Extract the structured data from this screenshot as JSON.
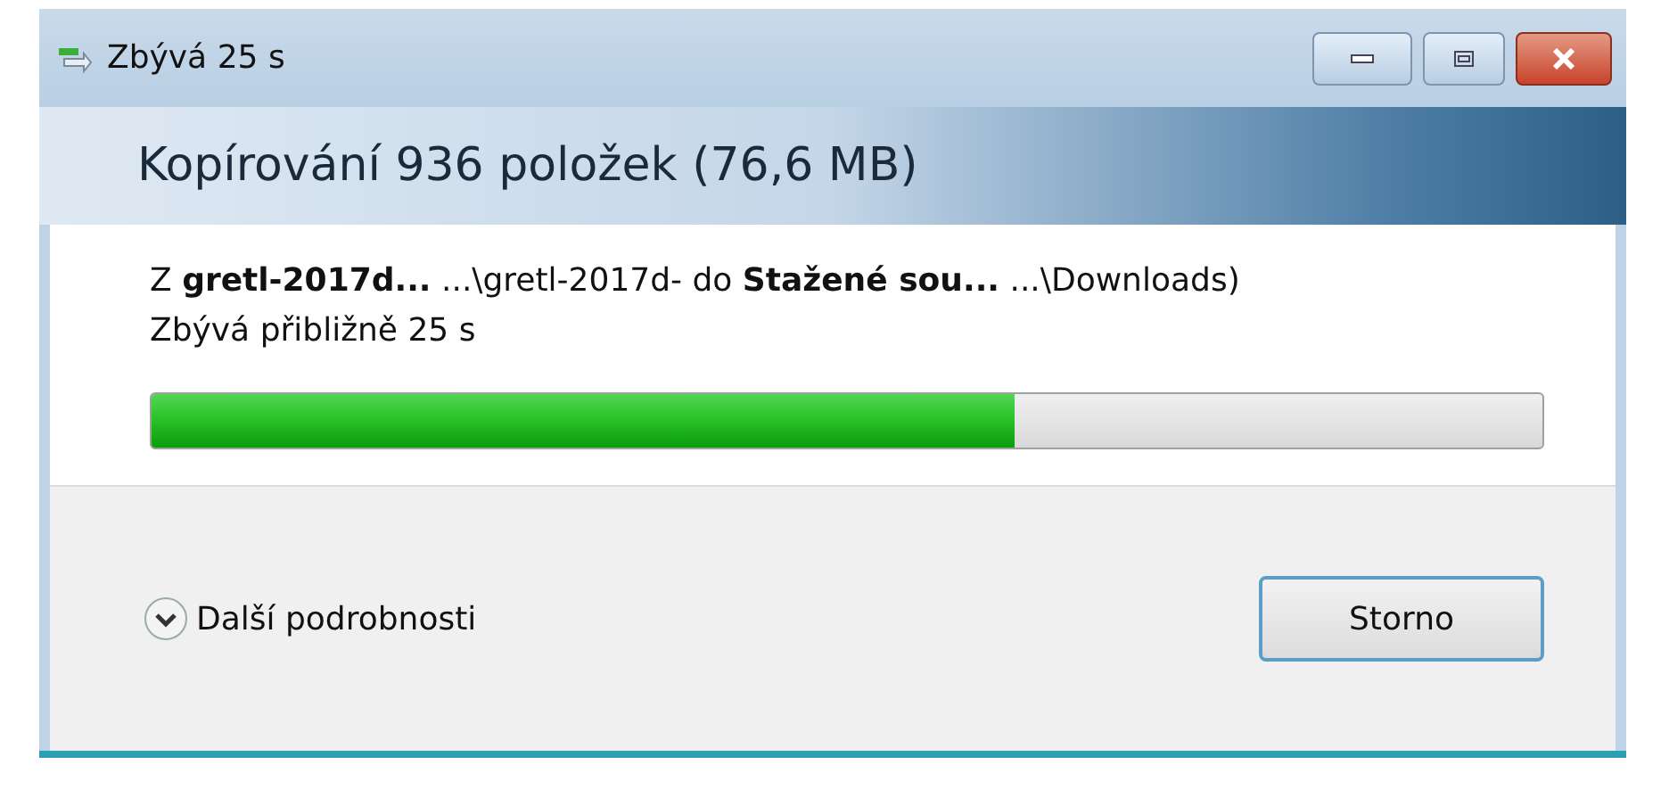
{
  "window": {
    "title": "Zbývá 25 s"
  },
  "header": {
    "title": "Kopírování 936 položek (76,6 MB)"
  },
  "source_line": "Z **gretl-2017d...**  ...\\gretl-2017d- do **Stažené sou...**  ...\\Downloads)",
  "time_remaining": "Zbývá přibližně 25 s",
  "progress": {
    "level": 0.62
  },
  "footer": {
    "details": {
      "label": "Další podrobnosti",
      "expanded": false
    },
    "buttons": [
      "Storno"
    ]
  }
}
